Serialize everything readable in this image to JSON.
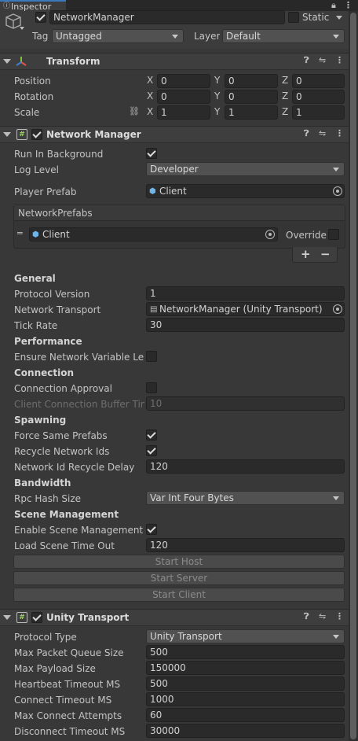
{
  "tab": {
    "title": "Inspector"
  },
  "gameobject": {
    "name": "NetworkManager",
    "static_label": "Static",
    "tag_label": "Tag",
    "tag_value": "Untagged",
    "layer_label": "Layer",
    "layer_value": "Default"
  },
  "transform": {
    "title": "Transform",
    "position_label": "Position",
    "rotation_label": "Rotation",
    "scale_label": "Scale",
    "axis_x": "X",
    "axis_y": "Y",
    "axis_z": "Z",
    "position": {
      "x": "0",
      "y": "0",
      "z": "0"
    },
    "rotation": {
      "x": "0",
      "y": "0",
      "z": "0"
    },
    "scale": {
      "x": "1",
      "y": "1",
      "z": "1"
    }
  },
  "network_manager": {
    "title": "Network Manager",
    "run_in_background_label": "Run In Background",
    "run_in_background": true,
    "log_level_label": "Log Level",
    "log_level": "Developer",
    "player_prefab_label": "Player Prefab",
    "player_prefab": "Client",
    "network_prefabs_label": "NetworkPrefabs",
    "network_prefab_item": "Client",
    "override_label": "Override",
    "add_button": "+",
    "remove_button": "−",
    "general_header": "General",
    "protocol_version_label": "Protocol Version",
    "protocol_version": "1",
    "network_transport_label": "Network Transport",
    "network_transport": "NetworkManager (Unity Transport)",
    "tick_rate_label": "Tick Rate",
    "tick_rate": "30",
    "performance_header": "Performance",
    "ensure_var_len_label": "Ensure Network Variable Leng",
    "connection_header": "Connection",
    "connection_approval_label": "Connection Approval",
    "client_buffer_label": "Client Connection Buffer Time",
    "client_buffer": "10",
    "spawning_header": "Spawning",
    "force_same_prefabs_label": "Force Same Prefabs",
    "recycle_ids_label": "Recycle Network Ids",
    "id_recycle_delay_label": "Network Id Recycle Delay",
    "id_recycle_delay": "120",
    "bandwidth_header": "Bandwidth",
    "rpc_hash_label": "Rpc Hash Size",
    "rpc_hash": "Var Int Four Bytes",
    "scene_header": "Scene Management",
    "enable_scene_label": "Enable Scene Management",
    "load_scene_timeout_label": "Load Scene Time Out",
    "load_scene_timeout": "120",
    "start_host": "Start Host",
    "start_server": "Start Server",
    "start_client": "Start Client"
  },
  "unity_transport": {
    "title": "Unity Transport",
    "protocol_type_label": "Protocol Type",
    "protocol_type": "Unity Transport",
    "max_packet_queue_label": "Max Packet Queue Size",
    "max_packet_queue": "500",
    "max_payload_label": "Max Payload Size",
    "max_payload": "150000",
    "heartbeat_label": "Heartbeat Timeout MS",
    "heartbeat": "500",
    "connect_timeout_label": "Connect Timeout MS",
    "connect_timeout": "1000",
    "max_connect_attempts_label": "Max Connect Attempts",
    "max_connect_attempts": "60",
    "disconnect_timeout_label": "Disconnect Timeout MS",
    "disconnect_timeout": "30000"
  },
  "icons": [
    "lock-icon",
    "more-icon",
    "cube-icon",
    "help-icon",
    "settings-icon",
    "script-icon",
    "transform-icon",
    "link-icon",
    "object-picker-icon"
  ]
}
